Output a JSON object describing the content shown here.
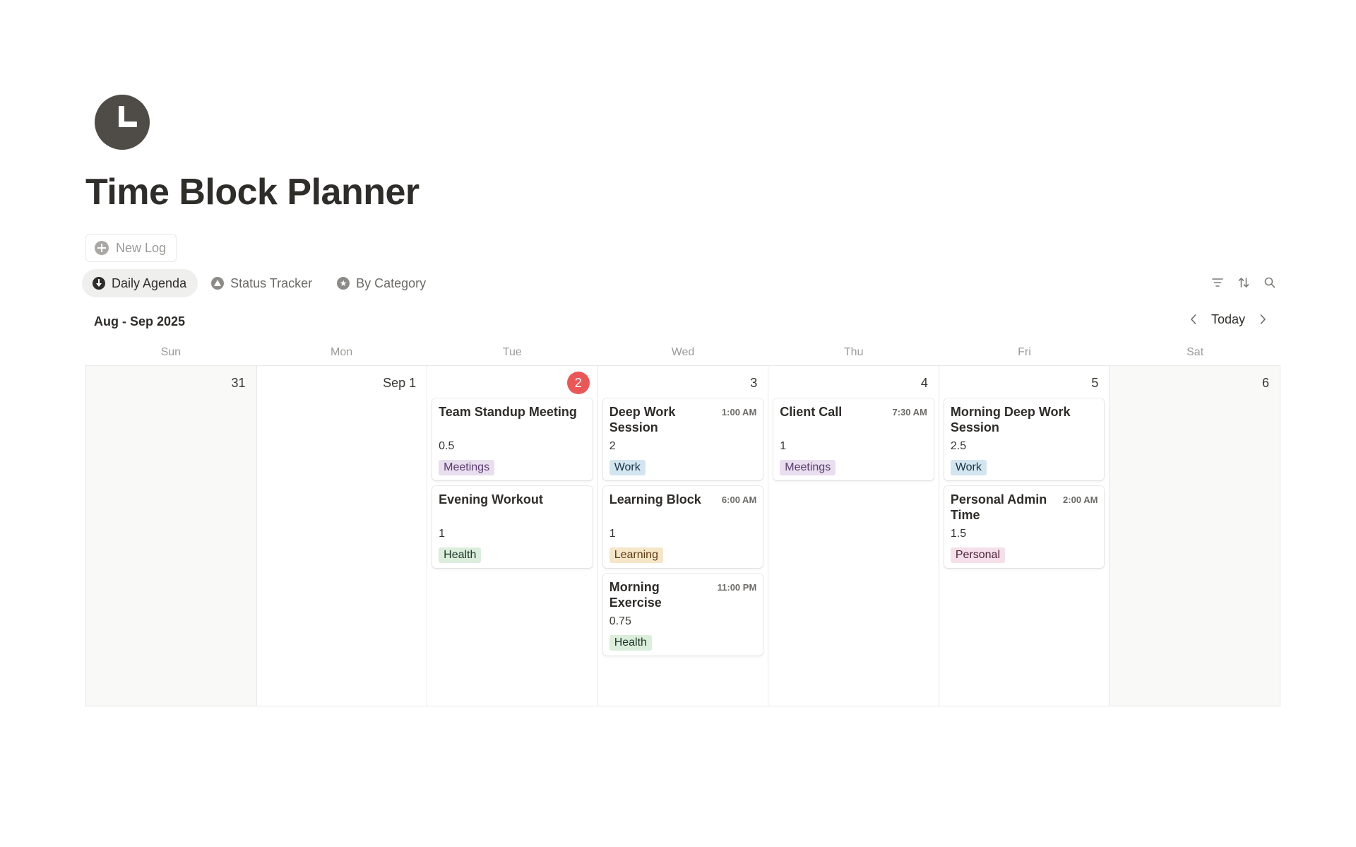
{
  "page": {
    "title": "Time Block Planner",
    "icon": "clock-icon"
  },
  "new_log": {
    "label": "New Log",
    "icon": "plus-circle-icon"
  },
  "views": [
    {
      "label": "Daily Agenda",
      "icon": "arrow-down-circle-icon",
      "active": true
    },
    {
      "label": "Status Tracker",
      "icon": "triangle-circle-icon",
      "active": false
    },
    {
      "label": "By Category",
      "icon": "star-circle-icon",
      "active": false
    }
  ],
  "toolbar": {
    "filter_icon": "filter-icon",
    "sort_icon": "sort-icon",
    "search_icon": "search-icon"
  },
  "calendar": {
    "range_label": "Aug - Sep 2025",
    "today_label": "Today",
    "weekdays": [
      "Sun",
      "Mon",
      "Tue",
      "Wed",
      "Thu",
      "Fri",
      "Sat"
    ],
    "days": [
      {
        "label": "31",
        "weekend": true,
        "today": false,
        "events": []
      },
      {
        "label": "Sep 1",
        "weekend": false,
        "today": false,
        "events": []
      },
      {
        "label": "2",
        "weekend": false,
        "today": true,
        "events": [
          {
            "title": "Team Standup Meeting",
            "time": "",
            "hours": "0.5",
            "tag": "Meetings"
          },
          {
            "title": "Evening Workout",
            "time": "",
            "hours": "1",
            "tag": "Health"
          }
        ]
      },
      {
        "label": "3",
        "weekend": false,
        "today": false,
        "events": [
          {
            "title": "Deep Work Session",
            "time": "1:00 AM",
            "hours": "2",
            "tag": "Work"
          },
          {
            "title": "Learning Block",
            "time": "6:00 AM",
            "hours": "1",
            "tag": "Learning"
          },
          {
            "title": "Morning Exercise",
            "time": "11:00 PM",
            "hours": "0.75",
            "tag": "Health"
          }
        ]
      },
      {
        "label": "4",
        "weekend": false,
        "today": false,
        "events": [
          {
            "title": "Client Call",
            "time": "7:30 AM",
            "hours": "1",
            "tag": "Meetings"
          }
        ]
      },
      {
        "label": "5",
        "weekend": false,
        "today": false,
        "events": [
          {
            "title": "Morning Deep Work Session",
            "time": "",
            "hours": "2.5",
            "tag": "Work"
          },
          {
            "title": "Personal Admin Time",
            "time": "2:00 AM",
            "hours": "1.5",
            "tag": "Personal"
          }
        ]
      },
      {
        "label": "6",
        "weekend": true,
        "today": false,
        "events": []
      }
    ]
  },
  "tag_colors": {
    "Meetings": {
      "bg": "#e8deee",
      "fg": "#5a3c6e"
    },
    "Health": {
      "bg": "#dbeddb",
      "fg": "#1c3829"
    },
    "Work": {
      "bg": "#d3e5ef",
      "fg": "#183347"
    },
    "Learning": {
      "bg": "#f6e6c8",
      "fg": "#5c3b12"
    },
    "Personal": {
      "bg": "#f5e0e9",
      "fg": "#4c2337"
    }
  },
  "colors": {
    "today_badge": "#eb5757",
    "text": "#37352f",
    "muted": "#9b9a97"
  }
}
